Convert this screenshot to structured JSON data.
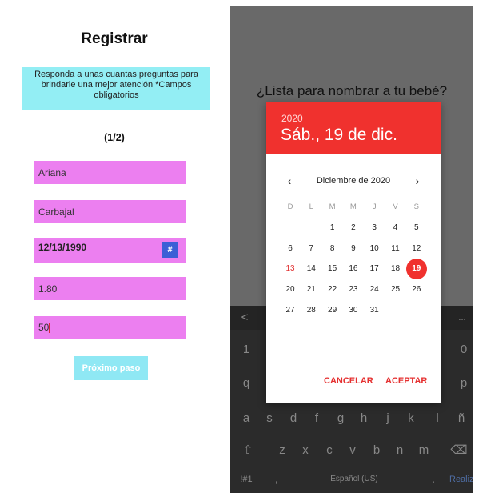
{
  "left": {
    "title": "Registrar",
    "intro": "Responda a unas cuantas  preguntas para brindarle una mejor atención *Campos obligatorios",
    "step": "(1/2)",
    "fields": {
      "first_name": "Ariana",
      "last_name": "Carbajal",
      "birth_date": "12/13/1990",
      "height": "1.80",
      "weight": "50"
    },
    "date_button": "#",
    "next_button": "Próximo paso",
    "colors": {
      "intro_bg": "#93eef4",
      "field_bg": "#ec7ff0",
      "button_bg": "#8fe8f4",
      "hash_bg": "#3c5fd6"
    }
  },
  "right": {
    "title": "¿Lista para nombrar a tu bebé?",
    "picker": {
      "year": "2020",
      "selected_long": "Sáb., 19 de dic.",
      "month_label": "Diciembre de 2020",
      "prev_icon": "‹",
      "next_icon": "›",
      "weekdays": [
        "D",
        "L",
        "M",
        "M",
        "J",
        "V",
        "S"
      ],
      "first_weekday_index": 2,
      "days_in_month": 31,
      "today": 13,
      "selected": 19,
      "cancel_label": "CANCELAR",
      "ok_label": "ACEPTAR",
      "accent": "#f0312e"
    },
    "keyboard": {
      "row_top": [
        "<",
        "..."
      ],
      "row_numbers": [
        "1",
        "0"
      ],
      "row1": [
        "q",
        "p"
      ],
      "row2": [
        "a",
        "s",
        "d",
        "f",
        "g",
        "h",
        "j",
        "k",
        "l",
        "ñ"
      ],
      "row3": [
        "⇧",
        "z",
        "x",
        "c",
        "v",
        "b",
        "n",
        "m",
        "⌫"
      ],
      "row4": {
        "sym": "!#1",
        "comma": ",",
        "space": "Español (US)",
        "period": ".",
        "action": "Realiz..."
      }
    }
  }
}
